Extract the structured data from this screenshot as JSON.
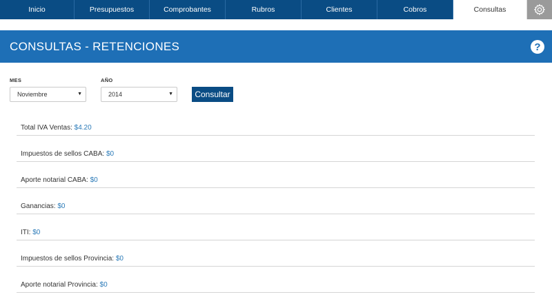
{
  "nav": {
    "tabs": [
      {
        "label": "Inicio"
      },
      {
        "label": "Presupuestos"
      },
      {
        "label": "Comprobantes"
      },
      {
        "label": "Rubros"
      },
      {
        "label": "Clientes"
      },
      {
        "label": "Cobros"
      },
      {
        "label": "Consultas"
      }
    ],
    "active": "Consultas",
    "settings_icon": "gear-icon"
  },
  "page": {
    "title": "CONSULTAS - RETENCIONES",
    "help_icon": "help-icon",
    "help_label": "?"
  },
  "filters": {
    "mes_label": "MES",
    "mes_value": "Noviembre",
    "anio_label": "AÑO",
    "anio_value": "2014",
    "submit_label": "Consultar"
  },
  "results": [
    {
      "label": "Total IVA Ventas:",
      "value": "$4.20"
    },
    {
      "label": "Impuestos de sellos CABA:",
      "value": "$0"
    },
    {
      "label": "Aporte notarial CABA:",
      "value": "$0"
    },
    {
      "label": "Ganancias:",
      "value": "$0"
    },
    {
      "label": "ITI:",
      "value": "$0"
    },
    {
      "label": "Impuestos de sellos Provincia:",
      "value": "$0"
    },
    {
      "label": "Aporte notarial Provincia:",
      "value": "$0"
    }
  ],
  "colors": {
    "nav_bg": "#0a4c84",
    "header_bg": "#1e6fb6",
    "value_text": "#2a7ab8",
    "gear_bg": "#9a9a9a"
  }
}
